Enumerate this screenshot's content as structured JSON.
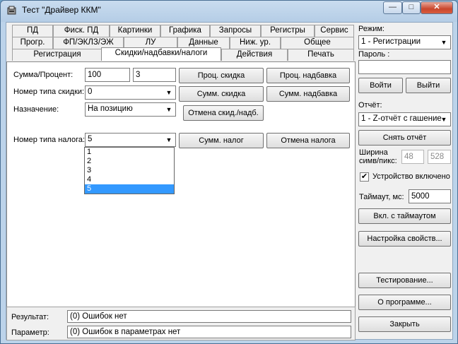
{
  "window": {
    "title": "Тест \"Драйвер ККМ\"",
    "minimize": "—",
    "maximize": "□",
    "close": "✕"
  },
  "tabs": {
    "row1": [
      "ПД",
      "Фиск. ПД",
      "Картинки",
      "Графика",
      "Запросы",
      "Регистры",
      "Сервис"
    ],
    "row2": [
      "Прогр.",
      "ФП/ЭКЛЗ/ЭЖ",
      "ЛУ",
      "Данные",
      "Ниж. ур.",
      "Общее"
    ],
    "row3": [
      "Регистрация",
      "Скидки/надбавки/налоги",
      "Действия",
      "Печать"
    ]
  },
  "form": {
    "sum_label": "Сумма/Процент:",
    "sum_value": "100",
    "percent_value": "3",
    "discount_type_label": "Номер типа скидки:",
    "discount_type_value": "0",
    "purpose_label": "Назначение:",
    "purpose_value": "На позицию",
    "tax_type_label": "Номер типа налога:",
    "tax_type_value": "5",
    "tax_options": [
      "1",
      "2",
      "3",
      "4",
      "5"
    ]
  },
  "buttons": {
    "percent_discount": "Проц. скидка",
    "percent_surcharge": "Проц. надбавка",
    "sum_discount": "Сумм. скидка",
    "sum_surcharge": "Сумм. надбавка",
    "cancel_discount": "Отмена скид./надб.",
    "sum_tax": "Сумм. налог",
    "cancel_tax": "Отмена налога"
  },
  "result": {
    "result_label": "Результат:",
    "result_value": "(0) Ошибок нет",
    "param_label": "Параметр:",
    "param_value": "(0) Ошибок в параметрах нет"
  },
  "right": {
    "mode_label": "Режим:",
    "mode_value": "1 - Регистрации",
    "password_label": "Пароль :",
    "password_value": "",
    "login": "Войти",
    "logout": "Выйти",
    "report_label": "Отчёт:",
    "report_value": "1 - Z-отчёт с гашение",
    "take_report": "Снять отчёт",
    "width_label": "Ширина",
    "width_label2": "симв/пикс:",
    "width_chars": "48",
    "width_px": "528",
    "device_on_label": "Устройство включено",
    "device_on_check": "✔",
    "timeout_label": "Таймаут, мс:",
    "timeout_value": "5000",
    "enable_timeout": "Вкл. с таймаутом",
    "properties": "Настройка свойств...",
    "testing": "Тестирование...",
    "about": "О программе...",
    "close": "Закрыть"
  }
}
